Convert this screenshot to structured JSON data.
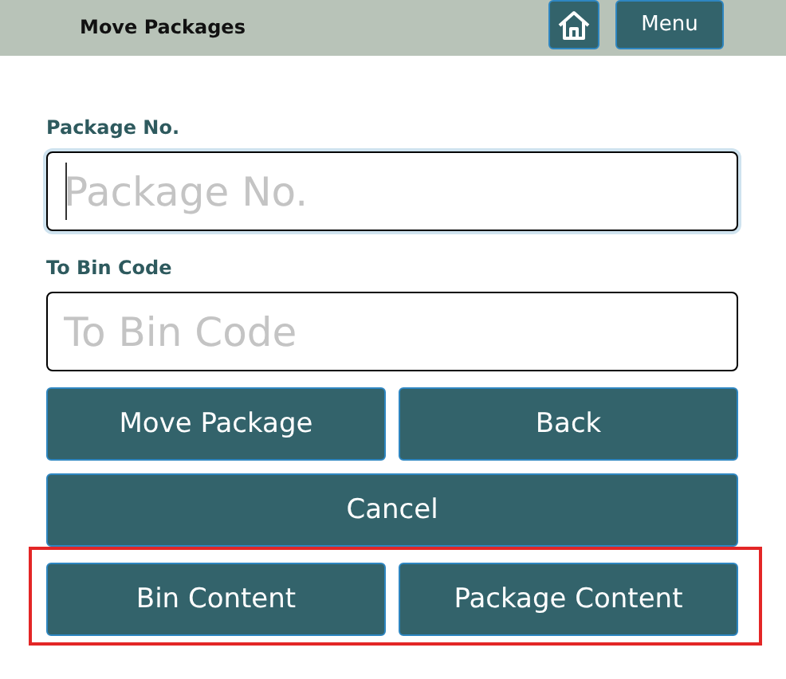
{
  "header": {
    "title": "Move Packages",
    "menu_button": "Menu"
  },
  "fields": [
    {
      "label": "Package No.",
      "placeholder": "Package No.",
      "focused": true
    },
    {
      "label": "To Bin Code",
      "placeholder": "To Bin Code",
      "focused": false
    }
  ],
  "button_rows": [
    [
      "Move Package",
      "Back"
    ],
    [
      "Cancel"
    ]
  ],
  "highlighted_buttons": [
    "Bin Content",
    "Package Content"
  ]
}
